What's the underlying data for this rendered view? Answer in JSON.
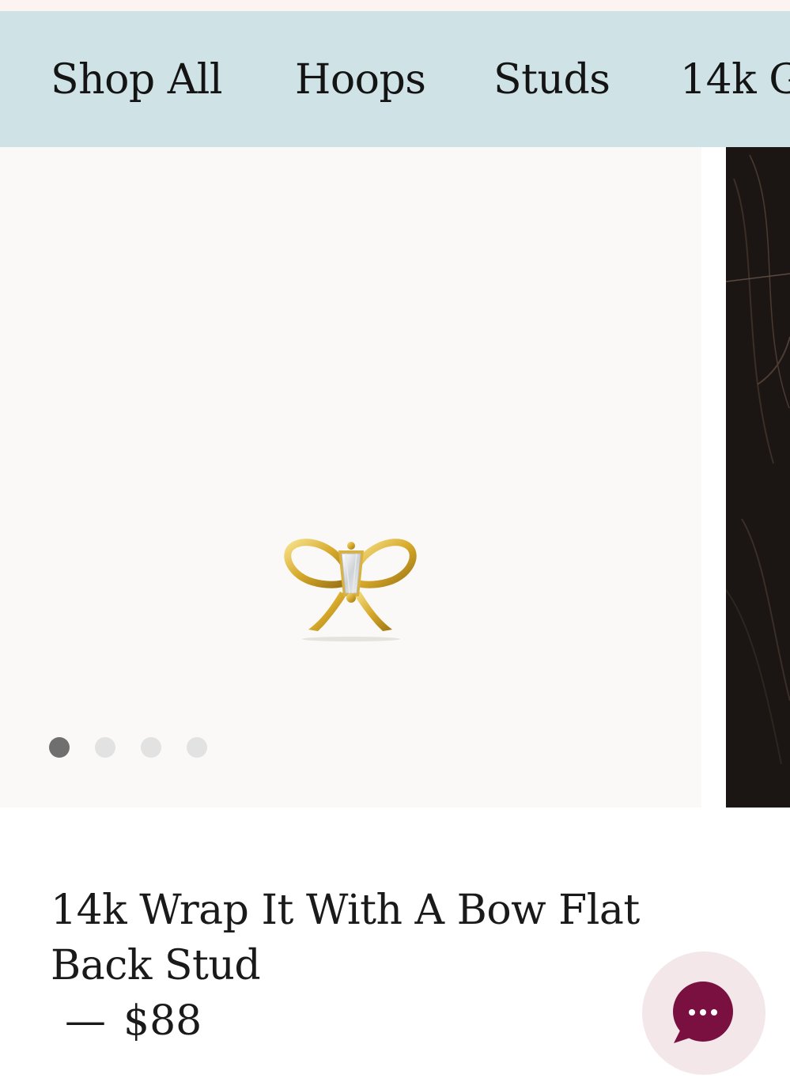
{
  "nav": {
    "items": [
      {
        "label": "Shop All"
      },
      {
        "label": "Hoops"
      },
      {
        "label": "Studs"
      },
      {
        "label": "14k G"
      }
    ]
  },
  "gallery": {
    "slide_count": 4,
    "active_slide": 1
  },
  "product": {
    "title": "14k Wrap It With A Bow Flat Back Stud",
    "price_separator": "—",
    "price": "$88"
  },
  "chat": {
    "icon": "chat-bubble-ellipsis-icon"
  },
  "colors": {
    "nav_background": "#cfe3e6",
    "gallery_background": "#fbf9f7",
    "chat_bubble": "#7a1040",
    "chat_halo": "#f3e7ea",
    "dot_active": "#6f6f6f",
    "dot_inactive": "#e2e2e2"
  }
}
